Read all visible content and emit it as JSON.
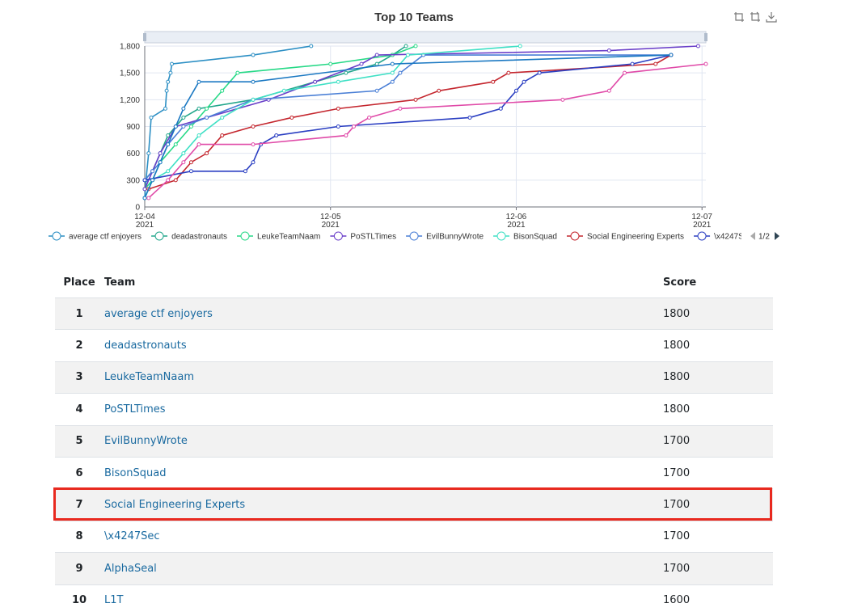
{
  "chart_data": {
    "type": "line",
    "title": "Top 10 Teams",
    "xaxis": {
      "ticks": [
        {
          "date": "2021-12-04",
          "label": "12-04",
          "sub": "2021"
        },
        {
          "date": "2021-12-05",
          "label": "12-05",
          "sub": "2021"
        },
        {
          "date": "2021-12-06",
          "label": "12-06",
          "sub": "2021"
        },
        {
          "date": "2021-12-07",
          "label": "12-07",
          "sub": "2021"
        }
      ],
      "range": [
        "2021-12-04T00:00",
        "2021-12-07T00:30"
      ]
    },
    "ylim": [
      0,
      1800
    ],
    "yticks": [
      "0",
      "300",
      "600",
      "900",
      "1,200",
      "1,500",
      "1,800"
    ],
    "grid": true,
    "legend_position": "bottom",
    "legend_page": "1/2",
    "series": [
      {
        "name": "average ctf enjoyers",
        "color": "#2c8fc4",
        "points": [
          [
            "2021-12-04T00:00",
            100
          ],
          [
            "2021-12-04T00:10",
            300
          ],
          [
            "2021-12-04T00:30",
            600
          ],
          [
            "2021-12-04T00:50",
            1000
          ],
          [
            "2021-12-04T02:40",
            1100
          ],
          [
            "2021-12-04T02:50",
            1300
          ],
          [
            "2021-12-04T03:00",
            1400
          ],
          [
            "2021-12-04T03:20",
            1500
          ],
          [
            "2021-12-04T03:30",
            1600
          ],
          [
            "2021-12-04T14:00",
            1700
          ],
          [
            "2021-12-04T21:30",
            1800
          ]
        ]
      },
      {
        "name": "deadastronauts",
        "color": "#22a68b",
        "points": [
          [
            "2021-12-04T00:00",
            300
          ],
          [
            "2021-12-04T01:00",
            400
          ],
          [
            "2021-12-04T02:00",
            600
          ],
          [
            "2021-12-04T03:00",
            800
          ],
          [
            "2021-12-04T05:00",
            1000
          ],
          [
            "2021-12-04T07:00",
            1100
          ],
          [
            "2021-12-04T14:00",
            1200
          ],
          [
            "2021-12-04T22:00",
            1400
          ],
          [
            "2021-12-05T02:00",
            1500
          ],
          [
            "2021-12-05T06:00",
            1600
          ],
          [
            "2021-12-05T08:00",
            1700
          ],
          [
            "2021-12-05T09:45",
            1800
          ]
        ]
      },
      {
        "name": "LeukeTeamNaam",
        "color": "#27d987",
        "points": [
          [
            "2021-12-04T00:00",
            200
          ],
          [
            "2021-12-04T01:00",
            300
          ],
          [
            "2021-12-04T02:00",
            500
          ],
          [
            "2021-12-04T04:00",
            700
          ],
          [
            "2021-12-04T06:00",
            900
          ],
          [
            "2021-12-04T08:00",
            1100
          ],
          [
            "2021-12-04T10:00",
            1300
          ],
          [
            "2021-12-04T12:00",
            1500
          ],
          [
            "2021-12-05T00:00",
            1600
          ],
          [
            "2021-12-05T08:00",
            1700
          ],
          [
            "2021-12-05T11:00",
            1800
          ]
        ]
      },
      {
        "name": "PoSTLTimes",
        "color": "#6a3fc9",
        "points": [
          [
            "2021-12-04T00:00",
            200
          ],
          [
            "2021-12-04T01:00",
            400
          ],
          [
            "2021-12-04T02:00",
            600
          ],
          [
            "2021-12-04T04:00",
            900
          ],
          [
            "2021-12-04T08:00",
            1000
          ],
          [
            "2021-12-04T16:00",
            1200
          ],
          [
            "2021-12-04T22:00",
            1400
          ],
          [
            "2021-12-05T04:00",
            1600
          ],
          [
            "2021-12-05T06:00",
            1700
          ],
          [
            "2021-12-06T12:00",
            1750
          ],
          [
            "2021-12-06T23:30",
            1800
          ]
        ]
      },
      {
        "name": "EvilBunnyWrote",
        "color": "#4a7fd6",
        "points": [
          [
            "2021-12-04T00:00",
            300
          ],
          [
            "2021-12-04T01:00",
            400
          ],
          [
            "2021-12-04T02:00",
            500
          ],
          [
            "2021-12-04T03:00",
            700
          ],
          [
            "2021-12-04T05:00",
            900
          ],
          [
            "2021-12-04T08:00",
            1000
          ],
          [
            "2021-12-04T14:00",
            1200
          ],
          [
            "2021-12-05T06:00",
            1300
          ],
          [
            "2021-12-05T08:00",
            1400
          ],
          [
            "2021-12-05T09:00",
            1500
          ],
          [
            "2021-12-05T12:00",
            1700
          ],
          [
            "2021-12-06T20:00",
            1700
          ]
        ]
      },
      {
        "name": "BisonSquad",
        "color": "#3fe0c5",
        "points": [
          [
            "2021-12-04T00:00",
            100
          ],
          [
            "2021-12-04T01:00",
            300
          ],
          [
            "2021-12-04T03:00",
            400
          ],
          [
            "2021-12-04T05:00",
            600
          ],
          [
            "2021-12-04T07:00",
            800
          ],
          [
            "2021-12-04T10:00",
            1000
          ],
          [
            "2021-12-04T14:00",
            1200
          ],
          [
            "2021-12-04T18:00",
            1300
          ],
          [
            "2021-12-05T01:00",
            1400
          ],
          [
            "2021-12-05T08:00",
            1500
          ],
          [
            "2021-12-05T10:00",
            1700
          ],
          [
            "2021-12-06T00:30",
            1800
          ]
        ]
      },
      {
        "name": "Social Engineering Experts",
        "color": "#c4262e",
        "points": [
          [
            "2021-12-04T00:30",
            200
          ],
          [
            "2021-12-04T04:00",
            300
          ],
          [
            "2021-12-04T06:00",
            500
          ],
          [
            "2021-12-04T08:00",
            600
          ],
          [
            "2021-12-04T10:00",
            800
          ],
          [
            "2021-12-04T14:00",
            900
          ],
          [
            "2021-12-04T19:00",
            1000
          ],
          [
            "2021-12-05T01:00",
            1100
          ],
          [
            "2021-12-05T11:00",
            1200
          ],
          [
            "2021-12-05T14:00",
            1300
          ],
          [
            "2021-12-05T21:00",
            1400
          ],
          [
            "2021-12-05T23:00",
            1500
          ],
          [
            "2021-12-06T18:00",
            1600
          ],
          [
            "2021-12-06T20:00",
            1700
          ]
        ]
      },
      {
        "name": "\\x4247Sec",
        "color": "#2b3fc2",
        "points": [
          [
            "2021-12-04T00:00",
            300
          ],
          [
            "2021-12-04T06:00",
            400
          ],
          [
            "2021-12-04T13:00",
            400
          ],
          [
            "2021-12-04T14:00",
            500
          ],
          [
            "2021-12-04T15:00",
            700
          ],
          [
            "2021-12-04T17:00",
            800
          ],
          [
            "2021-12-05T01:00",
            900
          ],
          [
            "2021-12-05T18:00",
            1000
          ],
          [
            "2021-12-05T22:00",
            1100
          ],
          [
            "2021-12-06T00:00",
            1300
          ],
          [
            "2021-12-06T01:00",
            1400
          ],
          [
            "2021-12-06T03:00",
            1500
          ],
          [
            "2021-12-06T15:00",
            1600
          ],
          [
            "2021-12-06T20:00",
            1700
          ]
        ]
      },
      {
        "name": "AlphaSeal",
        "color": "#1a78c2",
        "points": [
          [
            "2021-12-04T00:00",
            100
          ],
          [
            "2021-12-04T01:00",
            300
          ],
          [
            "2021-12-04T02:00",
            500
          ],
          [
            "2021-12-04T03:00",
            700
          ],
          [
            "2021-12-04T04:00",
            900
          ],
          [
            "2021-12-04T05:00",
            1100
          ],
          [
            "2021-12-04T07:00",
            1400
          ],
          [
            "2021-12-04T14:00",
            1400
          ],
          [
            "2021-12-05T08:00",
            1600
          ],
          [
            "2021-12-06T20:00",
            1700
          ]
        ]
      },
      {
        "name": "L1T",
        "color": "#e04aa8",
        "points": [
          [
            "2021-12-04T00:30",
            100
          ],
          [
            "2021-12-04T03:00",
            300
          ],
          [
            "2021-12-04T05:00",
            500
          ],
          [
            "2021-12-04T07:00",
            700
          ],
          [
            "2021-12-04T14:00",
            700
          ],
          [
            "2021-12-05T02:00",
            800
          ],
          [
            "2021-12-05T03:00",
            900
          ],
          [
            "2021-12-05T05:00",
            1000
          ],
          [
            "2021-12-05T09:00",
            1100
          ],
          [
            "2021-12-06T06:00",
            1200
          ],
          [
            "2021-12-06T12:00",
            1300
          ],
          [
            "2021-12-06T14:00",
            1500
          ],
          [
            "2021-12-07T00:30",
            1600
          ]
        ]
      }
    ]
  },
  "scoreboard": {
    "headers": {
      "place": "Place",
      "team": "Team",
      "score": "Score"
    },
    "highlighted_team": "Social Engineering Experts",
    "highlight_color": "#e8291f",
    "link_color": "#1a6aa0",
    "rows": [
      {
        "place": "1",
        "team": "average ctf enjoyers",
        "score": "1800"
      },
      {
        "place": "2",
        "team": "deadastronauts",
        "score": "1800"
      },
      {
        "place": "3",
        "team": "LeukeTeamNaam",
        "score": "1800"
      },
      {
        "place": "4",
        "team": "PoSTLTimes",
        "score": "1800"
      },
      {
        "place": "5",
        "team": "EvilBunnyWrote",
        "score": "1700"
      },
      {
        "place": "6",
        "team": "BisonSquad",
        "score": "1700"
      },
      {
        "place": "7",
        "team": "Social Engineering Experts",
        "score": "1700"
      },
      {
        "place": "8",
        "team": "\\x4247Sec",
        "score": "1700"
      },
      {
        "place": "9",
        "team": "AlphaSeal",
        "score": "1700"
      },
      {
        "place": "10",
        "team": "L1T",
        "score": "1600"
      }
    ]
  },
  "toolbox": {
    "icons": [
      "zoom-icon",
      "zoom-reset-icon",
      "download-icon"
    ]
  }
}
